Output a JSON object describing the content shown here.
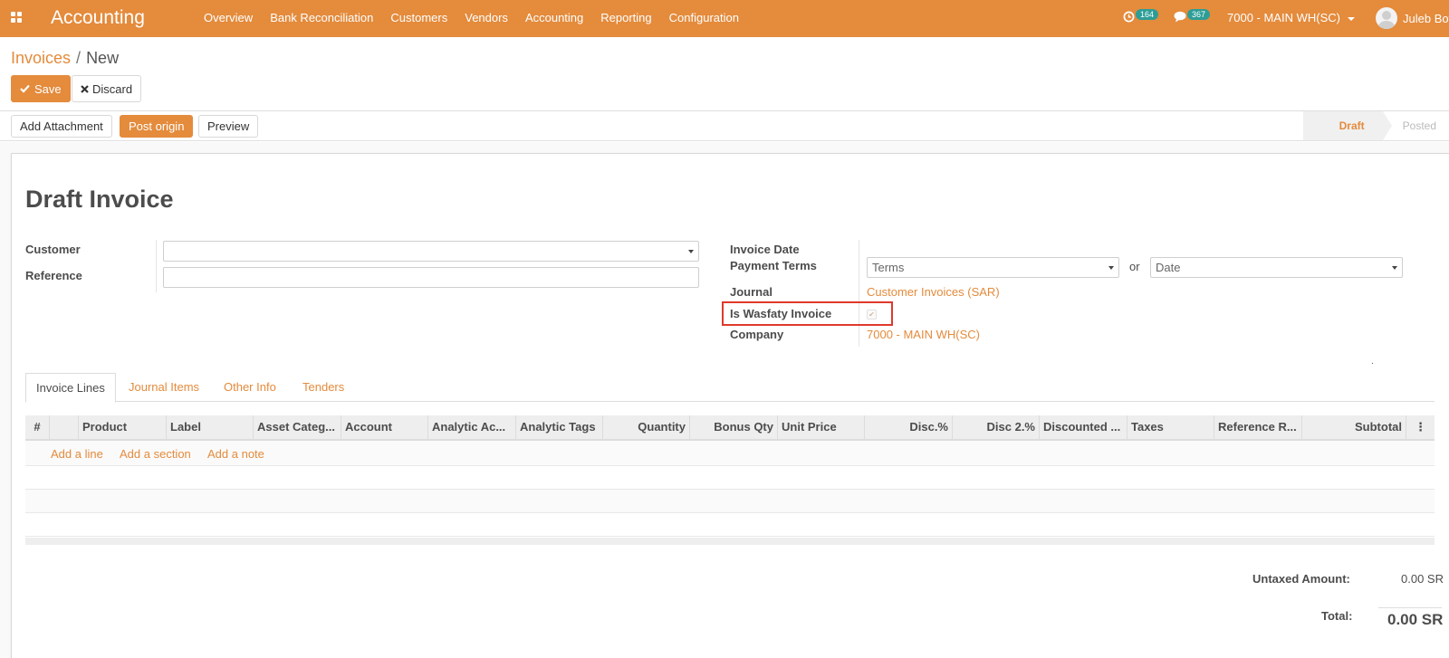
{
  "navbar": {
    "app_title": "Accounting",
    "menu": [
      "Overview",
      "Bank Reconciliation",
      "Customers",
      "Vendors",
      "Accounting",
      "Reporting",
      "Configuration"
    ],
    "activity_count": "164",
    "messages_count": "367",
    "company": "7000 - MAIN WH(SC)",
    "user": "Juleb Bot"
  },
  "breadcrumb": {
    "parent": "Invoices",
    "separator": "/",
    "current": "New"
  },
  "buttons": {
    "save": "Save",
    "discard": "Discard"
  },
  "statusbar": {
    "add_attachment": "Add Attachment",
    "post_origin": "Post origin",
    "preview": "Preview",
    "stages": [
      "Draft",
      "Posted"
    ],
    "active_stage": "Draft"
  },
  "form": {
    "title": "Draft Invoice",
    "customer_label": "Customer",
    "customer_value": "",
    "reference_label": "Reference",
    "reference_value": "",
    "invoice_date_label": "Invoice Date",
    "payment_terms_label": "Payment Terms",
    "payment_terms_placeholder": "Terms",
    "or_text": "or",
    "date_placeholder": "Date",
    "journal_label": "Journal",
    "journal_value": "Customer Invoices (SAR)",
    "wasfaty_label": "Is Wasfaty Invoice",
    "wasfaty_checked": true,
    "company_label": "Company",
    "company_value": "7000 - MAIN WH(SC)",
    "dot": "."
  },
  "tabs": [
    "Invoice Lines",
    "Journal Items",
    "Other Info",
    "Tenders"
  ],
  "table": {
    "columns": [
      "#",
      "Product",
      "Label",
      "Asset Categ...",
      "Account",
      "Analytic Ac...",
      "Analytic Tags",
      "Quantity",
      "Bonus Qty",
      "Unit Price",
      "Disc.%",
      "Disc 2.%",
      "Discounted ...",
      "Taxes",
      "Reference R...",
      "Subtotal"
    ],
    "menu_icon": "⋮",
    "add_line": "Add a line",
    "add_section": "Add a section",
    "add_note": "Add a note"
  },
  "totals": {
    "untaxed_label": "Untaxed Amount:",
    "untaxed_value": "0.00 SR",
    "total_label": "Total:",
    "total_value": "0.00 SR"
  },
  "colors": {
    "brand": "#e48b3c",
    "badge": "#2d9e97",
    "highlight": "#e0392b"
  }
}
